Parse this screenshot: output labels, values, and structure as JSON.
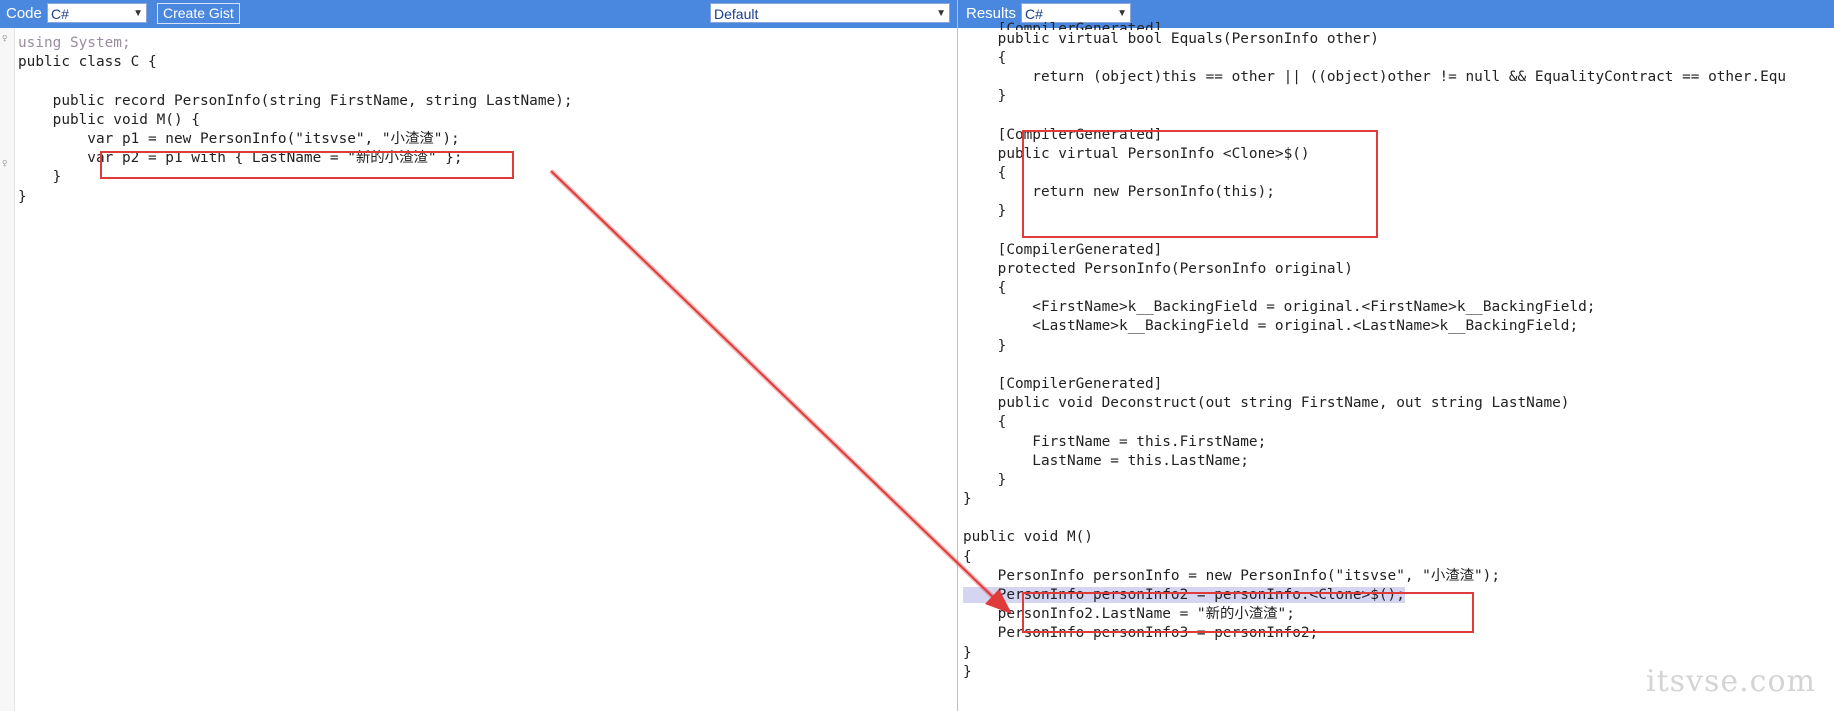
{
  "code_panel": {
    "label": "Code",
    "language": "C#",
    "create_gist": "Create Gist",
    "mode": "Default",
    "lines": [
      "using System;",
      "public class C {",
      "",
      "    public record PersonInfo(string FirstName, string LastName);",
      "    public void M() {",
      "        var p1 = new PersonInfo(\"itsvse\", \"小渣渣\");",
      "        var p2 = p1 with { LastName = \"新的小渣渣\" };",
      "    }",
      "}"
    ]
  },
  "results_panel": {
    "label": "Results",
    "language": "C#",
    "lines": [
      "    [CompilerGenerated]",
      "    public virtual bool Equals(PersonInfo other)",
      "    {",
      "        return (object)this == other || ((object)other != null && EqualityContract == other.Equ",
      "    }",
      "",
      "    [CompilerGenerated]",
      "    public virtual PersonInfo <Clone>$()",
      "    {",
      "        return new PersonInfo(this);",
      "    }",
      "",
      "    [CompilerGenerated]",
      "    protected PersonInfo(PersonInfo original)",
      "    {",
      "        <FirstName>k__BackingField = original.<FirstName>k__BackingField;",
      "        <LastName>k__BackingField = original.<LastName>k__BackingField;",
      "    }",
      "",
      "    [CompilerGenerated]",
      "    public void Deconstruct(out string FirstName, out string LastName)",
      "    {",
      "        FirstName = this.FirstName;",
      "        LastName = this.LastName;",
      "    }",
      "}",
      "",
      "public void M()",
      "{",
      "    PersonInfo personInfo = new PersonInfo(\"itsvse\", \"小渣渣\");",
      "    PersonInfo personInfo2 = personInfo.<Clone>$();",
      "    personInfo2.LastName = \"新的小渣渣\";",
      "    PersonInfo personInfo3 = personInfo2;",
      "}",
      "}"
    ]
  },
  "watermark": "itsvse.com",
  "colors": {
    "topbar": "#4a87de",
    "keyword": "#2222aa",
    "type": "#2b91af",
    "string": "#a31515",
    "annotation": "#e03b3b",
    "highlight": "#d5d5f2"
  }
}
